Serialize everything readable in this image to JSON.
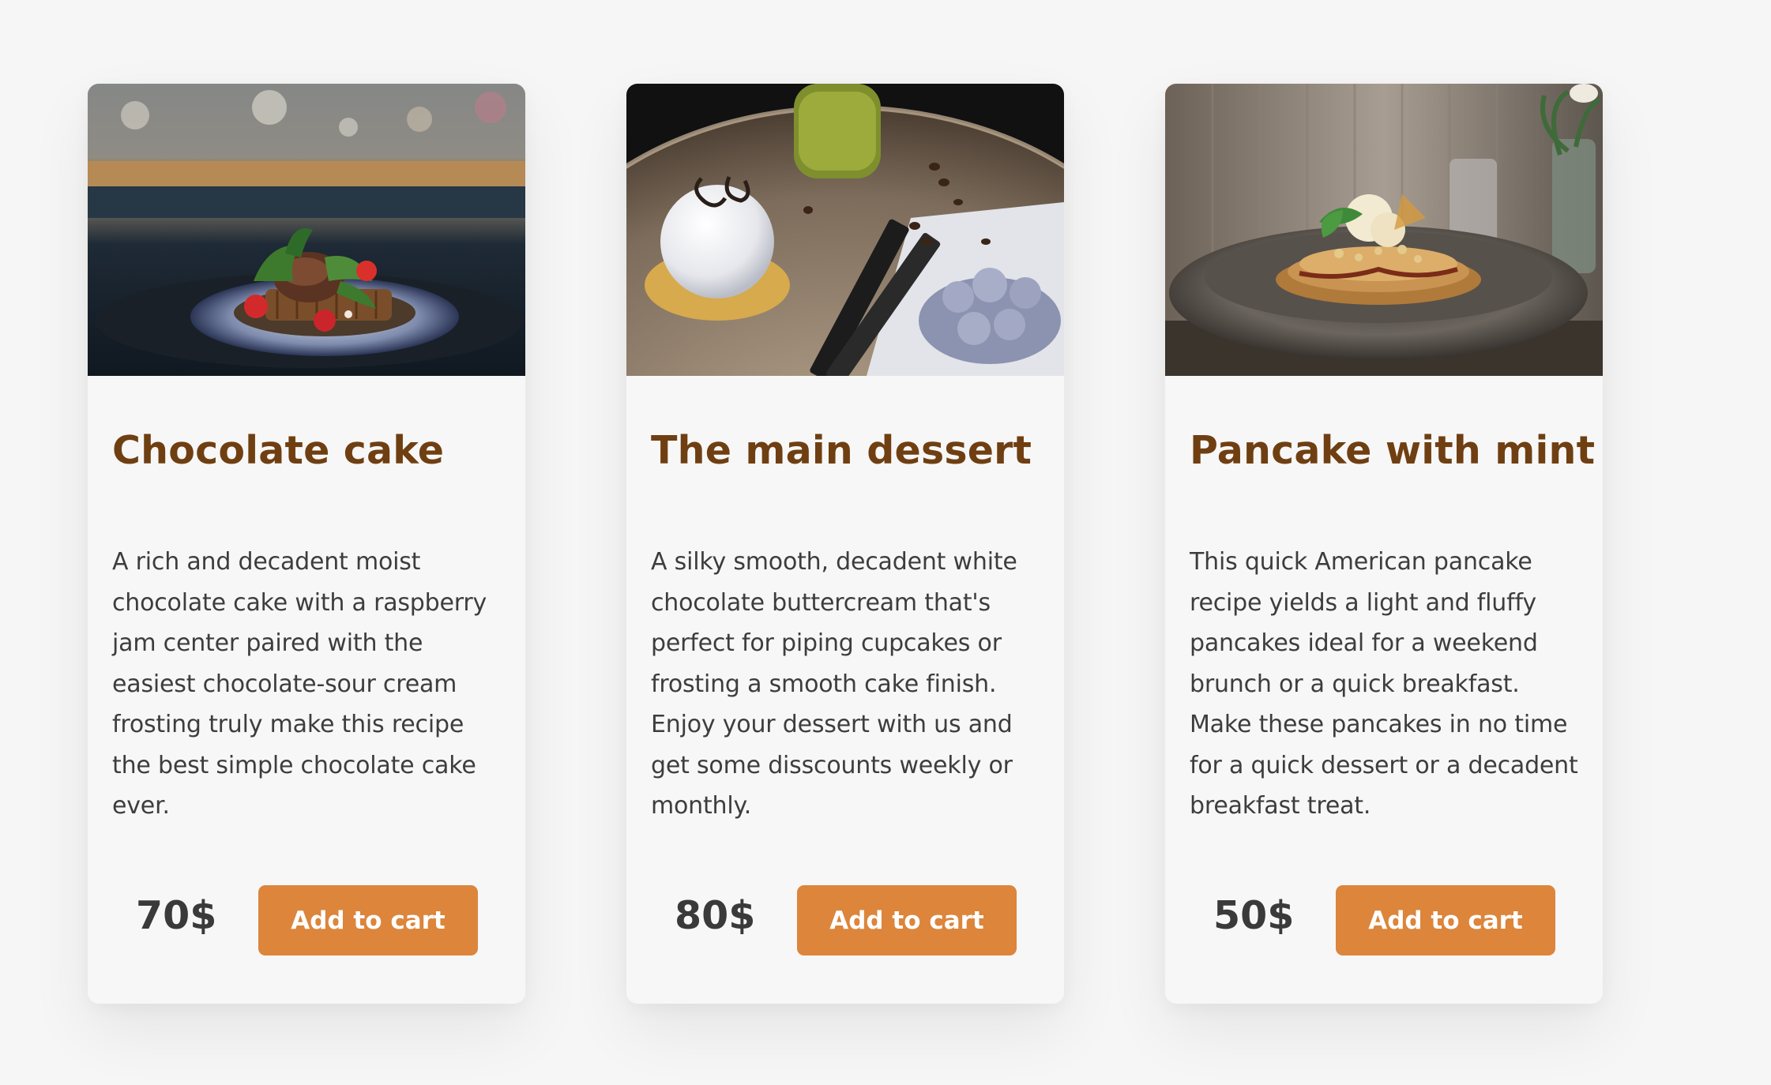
{
  "products": [
    {
      "title": "Chocolate cake",
      "description": "A rich and decadent moist chocolate cake with a raspberry jam center paired with the easiest chocolate-sour cream frosting truly make this recipe the best simple chocolate cake ever.",
      "price": "70$",
      "button_label": "Add to cart",
      "image": "waffle-with-berries-photo"
    },
    {
      "title": "The main dessert",
      "description": "A silky smooth, decadent white chocolate buttercream that's perfect for piping cupcakes or frosting a smooth cake finish. Enjoy your dessert with us and get some disscounts weekly or monthly.",
      "price": "80$",
      "button_label": "Add to cart",
      "image": "white-dessert-and-matcha-photo"
    },
    {
      "title": "Pancake with mint",
      "description": "This quick American pancake recipe yields a light and fluffy pancakes ideal for a weekend brunch or a quick breakfast. Make these pancakes in no time for a quick dessert or a decadent breakfast treat.",
      "price": "50$",
      "button_label": "Add to cart",
      "image": "pancakes-with-mint-photo"
    }
  ],
  "colors": {
    "page_background": "#f6f6f6",
    "card_background": "#f7f7f7",
    "title": "#6f3f12",
    "body_text": "#3d3d3d",
    "price": "#3a3a3a",
    "button": "#dc853b",
    "button_text": "#ffffff"
  }
}
